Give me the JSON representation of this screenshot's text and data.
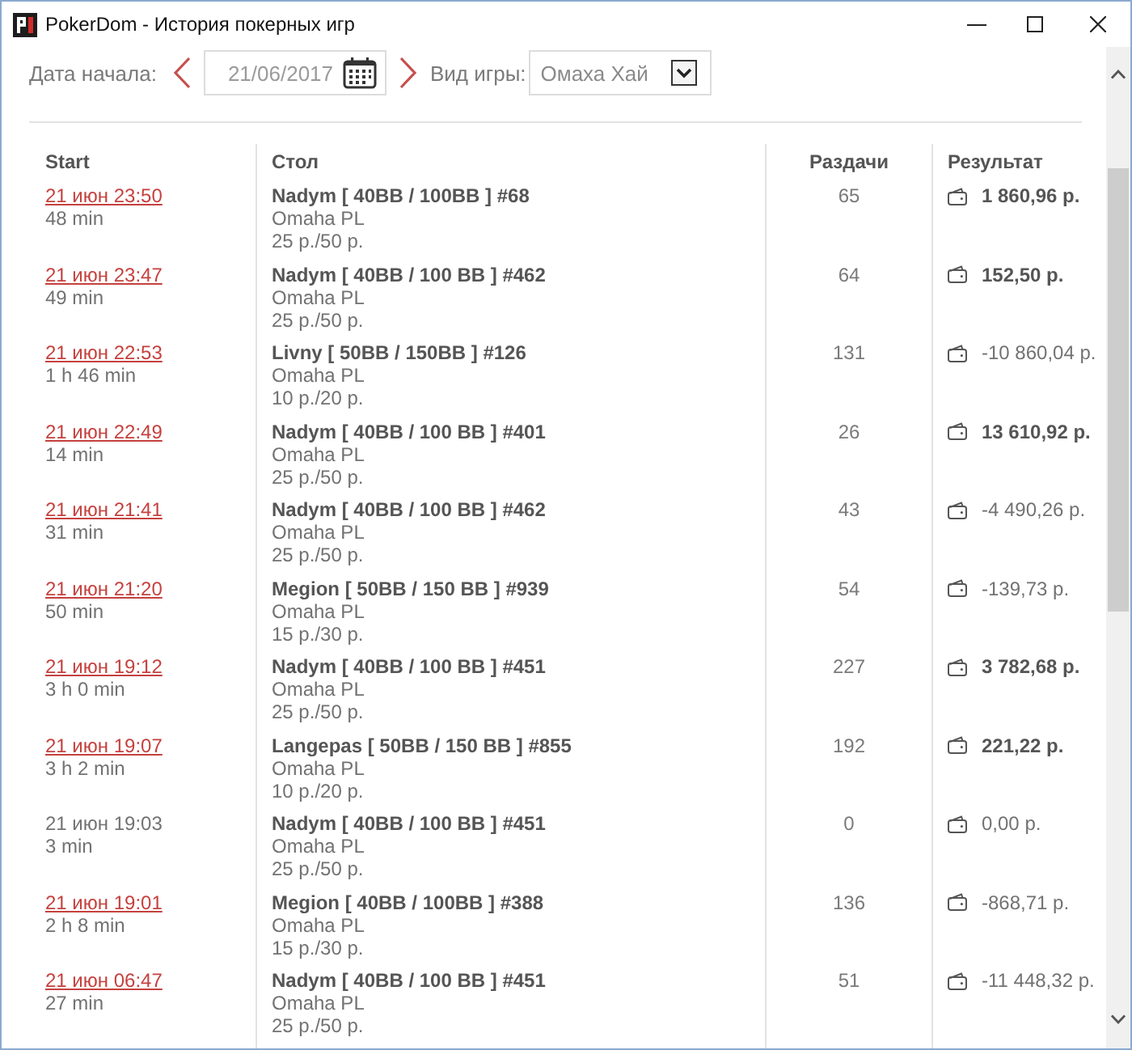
{
  "window": {
    "title": "PokerDom - История покерных игр"
  },
  "filters": {
    "date_label": "Дата начала:",
    "date": "21/06/2017",
    "game_label": "Вид игры:",
    "game": "Омаха Хай"
  },
  "table": {
    "columns": [
      "Start",
      "Стол",
      "Раздачи",
      "Результат"
    ],
    "rows": [
      {
        "start": "21 июн 23:50",
        "linked": true,
        "duration": "48 min",
        "table": "Nadym [ 40BB / 100BB ] #68",
        "game": "Omaha PL",
        "stakes": "25 р./50 р.",
        "hands": "65",
        "result": "1 860,96 р.",
        "emphasized": true
      },
      {
        "start": "21 июн 23:47",
        "linked": true,
        "duration": "49 min",
        "table": "Nadym [ 40BB / 100 BB ] #462",
        "game": "Omaha PL",
        "stakes": "25 р./50 р.",
        "hands": "64",
        "result": "152,50 р.",
        "emphasized": true
      },
      {
        "start": "21 июн 22:53",
        "linked": true,
        "duration": "1 h 46 min",
        "table": "Livny [ 50BB / 150BB ] #126",
        "game": "Omaha PL",
        "stakes": "10 р./20 р.",
        "hands": "131",
        "result": "-10 860,04 р.",
        "emphasized": false
      },
      {
        "start": "21 июн 22:49",
        "linked": true,
        "duration": "14 min",
        "table": "Nadym [ 40BB / 100 BB ] #401",
        "game": "Omaha PL",
        "stakes": "25 р./50 р.",
        "hands": "26",
        "result": "13 610,92 р.",
        "emphasized": true
      },
      {
        "start": "21 июн 21:41",
        "linked": true,
        "duration": "31 min",
        "table": "Nadym [ 40BB / 100 BB ] #462",
        "game": "Omaha PL",
        "stakes": "25 р./50 р.",
        "hands": "43",
        "result": "-4 490,26 р.",
        "emphasized": false
      },
      {
        "start": "21 июн 21:20",
        "linked": true,
        "duration": "50 min",
        "table": "Megion [ 50BB / 150 BB ] #939",
        "game": "Omaha PL",
        "stakes": "15 р./30 р.",
        "hands": "54",
        "result": "-139,73 р.",
        "emphasized": false
      },
      {
        "start": "21 июн 19:12",
        "linked": true,
        "duration": "3 h 0 min",
        "table": "Nadym [ 40BB / 100 BB ] #451",
        "game": "Omaha PL",
        "stakes": "25 р./50 р.",
        "hands": "227",
        "result": "3 782,68 р.",
        "emphasized": true
      },
      {
        "start": "21 июн 19:07",
        "linked": true,
        "duration": "3 h 2 min",
        "table": "Langepas [ 50BB / 150 BB ] #855",
        "game": "Omaha PL",
        "stakes": "10 р./20 р.",
        "hands": "192",
        "result": "221,22 р.",
        "emphasized": true
      },
      {
        "start": "21 июн 19:03",
        "linked": false,
        "duration": "3 min",
        "table": "Nadym [ 40BB / 100 BB ] #451",
        "game": "Omaha PL",
        "stakes": "25 р./50 р.",
        "hands": "0",
        "result": "0,00 р.",
        "emphasized": false
      },
      {
        "start": "21 июн 19:01",
        "linked": true,
        "duration": "2 h 8 min",
        "table": "Megion [ 40BB / 100BB ] #388",
        "game": "Omaha PL",
        "stakes": "15 р./30 р.",
        "hands": "136",
        "result": "-868,71 р.",
        "emphasized": false
      },
      {
        "start": "21 июн 06:47",
        "linked": true,
        "duration": "27 min",
        "table": "Nadym [ 40BB / 100 BB ] #451",
        "game": "Omaha PL",
        "stakes": "25 р./50 р.",
        "hands": "51",
        "result": "-11 448,32 р.",
        "emphasized": false
      }
    ]
  }
}
